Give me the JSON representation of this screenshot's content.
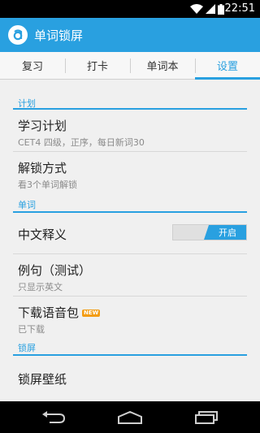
{
  "status_bar": {
    "time": "22:51",
    "icons": [
      "wifi-icon",
      "signal-icon",
      "battery-icon"
    ]
  },
  "app": {
    "title": "单词锁屏",
    "logo_icon": "app-logo-icon",
    "accent": "#29a0e0"
  },
  "tabs": [
    {
      "label": "复习",
      "active": false
    },
    {
      "label": "打卡",
      "active": false
    },
    {
      "label": "单词本",
      "active": false
    },
    {
      "label": "设置",
      "active": true
    }
  ],
  "sections": {
    "plan": {
      "header": "计划",
      "study_plan": {
        "title": "学习计划",
        "subtitle": "CET4 四级，正序，每日新词30"
      },
      "unlock_mode": {
        "title": "解锁方式",
        "subtitle": "看3个单词解锁"
      }
    },
    "words": {
      "header": "单词",
      "chinese_meaning": {
        "title": "中文释义",
        "toggle_label": "开启",
        "enabled": true
      },
      "example": {
        "title": "例句（测试）",
        "subtitle": "只显示英文"
      },
      "voice_pack": {
        "title": "下载语音包",
        "badge": "NEW",
        "subtitle": "已下载"
      }
    },
    "lockscreen": {
      "header": "锁屏",
      "wallpaper": {
        "title": "锁屏壁纸"
      }
    }
  },
  "nav_bar": {
    "icons": [
      "back-icon",
      "home-icon",
      "recent-apps-icon"
    ]
  }
}
